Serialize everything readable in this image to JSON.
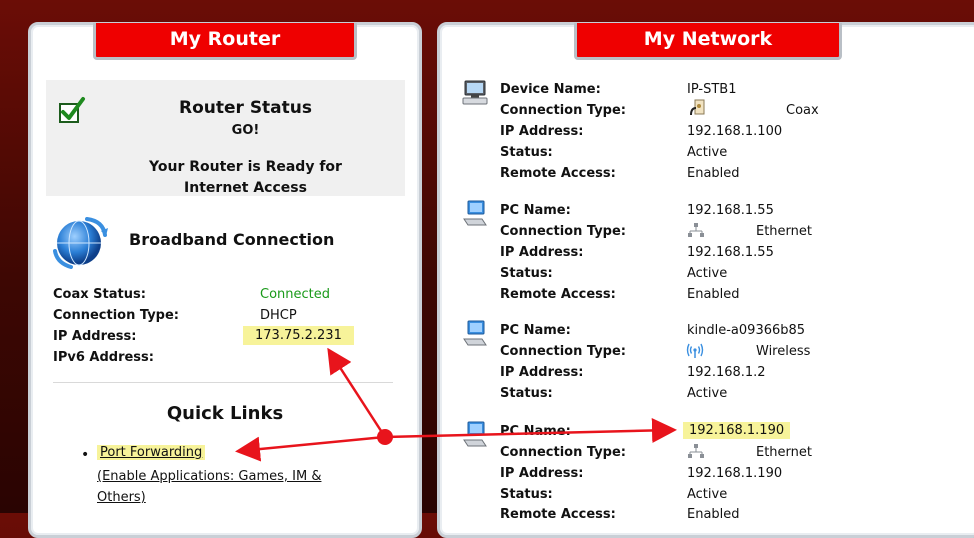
{
  "router": {
    "tab_title": "My Router",
    "status": {
      "title": "Router Status",
      "state": "GO!",
      "message_line1": "Your Router is Ready for",
      "message_line2": "Internet Access"
    },
    "broadband": {
      "title": "Broadband Connection",
      "rows": [
        {
          "label": "Coax Status:",
          "value": "Connected"
        },
        {
          "label": "Connection Type:",
          "value": "DHCP"
        },
        {
          "label": "IP Address:",
          "value": "173.75.2.231"
        },
        {
          "label": "IPv6 Address:",
          "value": ""
        }
      ]
    },
    "quick_links": {
      "title": "Quick Links",
      "items": [
        {
          "label": "Port Forwarding",
          "description": "(Enable Applications: Games, IM & Others)"
        }
      ]
    }
  },
  "network": {
    "tab_title": "My Network",
    "devices": [
      {
        "icon": "set-top-box-icon",
        "rows": [
          {
            "label": "Device Name:",
            "value": "IP-STB1"
          },
          {
            "label": "Connection Type:",
            "value": "Coax",
            "icon": "coax-icon"
          },
          {
            "label": "IP Address:",
            "value": "192.168.1.100"
          },
          {
            "label": "Status:",
            "value": "Active"
          },
          {
            "label": "Remote Access:",
            "value": "Enabled"
          }
        ]
      },
      {
        "icon": "pc-icon",
        "rows": [
          {
            "label": "PC Name:",
            "value": "192.168.1.55"
          },
          {
            "label": "Connection Type:",
            "value": "Ethernet",
            "icon": "ethernet-icon"
          },
          {
            "label": "IP Address:",
            "value": "192.168.1.55"
          },
          {
            "label": "Status:",
            "value": "Active"
          },
          {
            "label": "Remote Access:",
            "value": "Enabled"
          }
        ]
      },
      {
        "icon": "pc-icon",
        "rows": [
          {
            "label": "PC Name:",
            "value": "kindle-a09366b85"
          },
          {
            "label": "Connection Type:",
            "value": "Wireless",
            "icon": "wireless-icon"
          },
          {
            "label": "IP Address:",
            "value": "192.168.1.2"
          },
          {
            "label": "Status:",
            "value": "Active"
          }
        ]
      },
      {
        "icon": "pc-icon",
        "rows": [
          {
            "label": "PC Name:",
            "value": "192.168.1.190"
          },
          {
            "label": "Connection Type:",
            "value": "Ethernet",
            "icon": "ethernet-icon"
          },
          {
            "label": "IP Address:",
            "value": "192.168.1.190"
          },
          {
            "label": "Status:",
            "value": "Active"
          },
          {
            "label": "Remote Access:",
            "value": "Enabled"
          }
        ]
      }
    ]
  },
  "colors": {
    "tab_red": "#ef0000",
    "connected_green": "#1a9a1a",
    "highlight_yellow": "#f7f39a",
    "annotation_red": "#e8141c"
  }
}
